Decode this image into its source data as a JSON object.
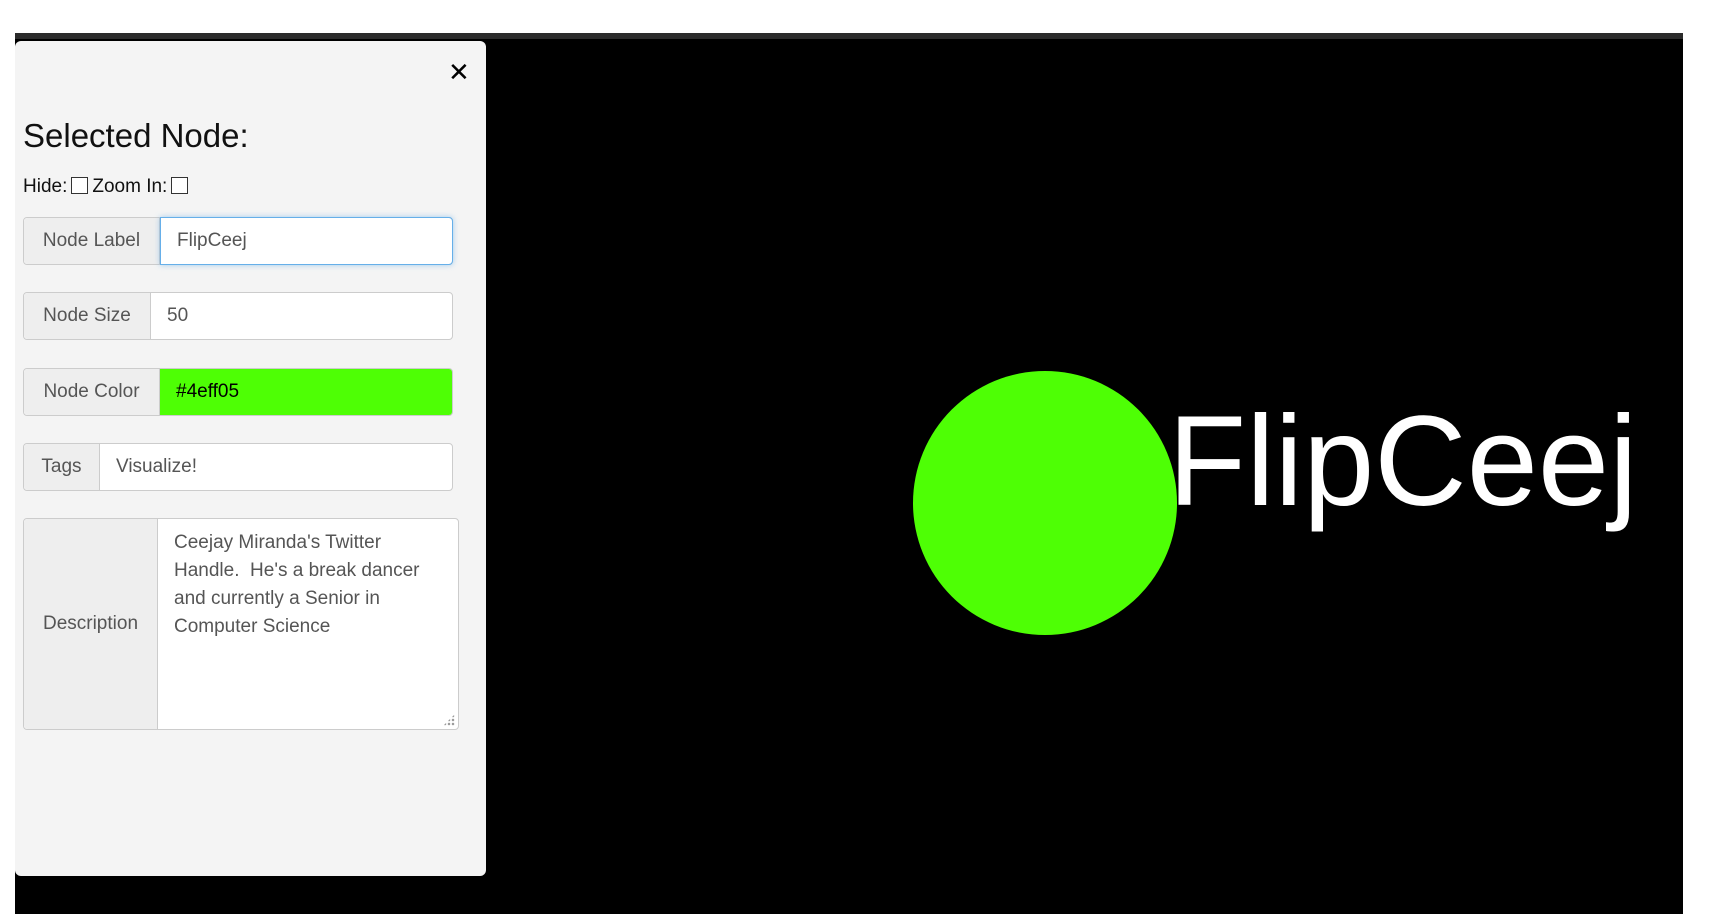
{
  "panel": {
    "close_glyph": "✕",
    "title": "Selected Node:",
    "hide_label": "Hide:",
    "zoom_label": "Zoom In:",
    "hide_checked": false,
    "zoom_checked": false,
    "fields": {
      "label": {
        "addon": "Node Label",
        "value": "FlipCeej"
      },
      "size": {
        "addon": "Node Size",
        "value": "50"
      },
      "color": {
        "addon": "Node Color",
        "value": "#4eff05"
      },
      "tags": {
        "addon": "Tags",
        "value": "Visualize!"
      },
      "description": {
        "addon": "Description",
        "value": "Ceejay Miranda's Twitter Handle.  He's a break dancer and currently a Senior in Computer Science"
      }
    }
  },
  "graph": {
    "background": "#000000",
    "node": {
      "label": "FlipCeej",
      "color": "#4eff05"
    }
  },
  "colors": {
    "panel_bg": "#f4f4f4",
    "focus_border": "#66afe9"
  }
}
